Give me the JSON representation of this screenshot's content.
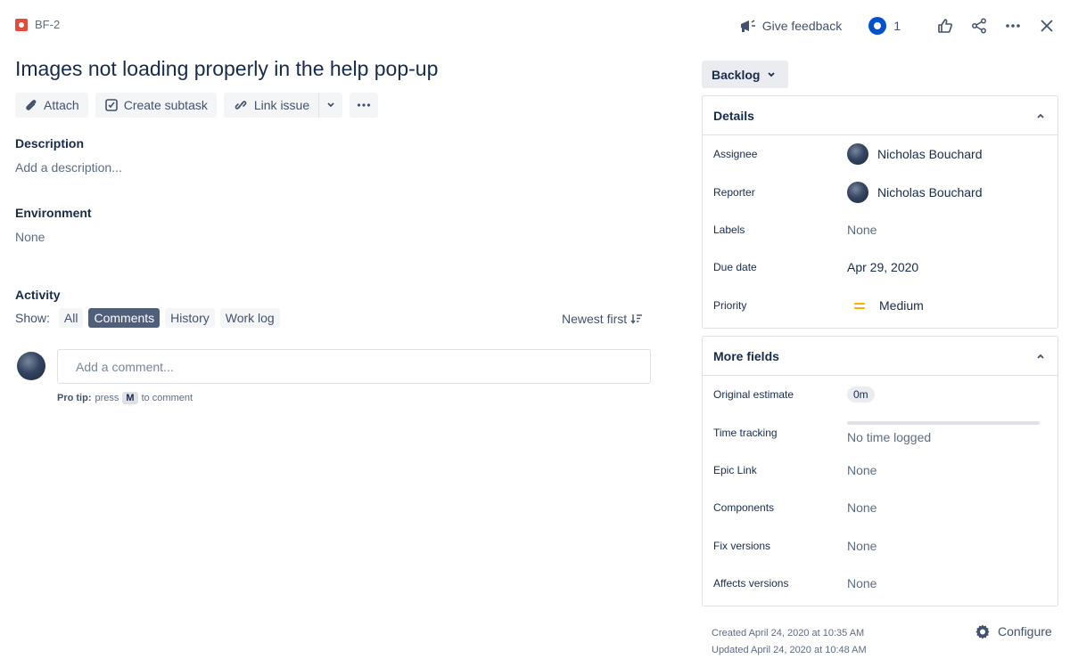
{
  "issue": {
    "key": "BF-2",
    "title": "Images not loading properly in the help pop-up"
  },
  "top_actions": {
    "feedback_label": "Give feedback",
    "watch_count": "1"
  },
  "actions": {
    "attach": "Attach",
    "create_subtask": "Create subtask",
    "link_issue": "Link issue"
  },
  "description": {
    "label": "Description",
    "placeholder": "Add a description..."
  },
  "environment": {
    "label": "Environment",
    "value": "None"
  },
  "activity": {
    "label": "Activity",
    "show_label": "Show:",
    "filters": [
      "All",
      "Comments",
      "History",
      "Work log"
    ],
    "active_filter": "Comments",
    "sort_label": "Newest first",
    "comment_placeholder": "Add a comment...",
    "protip_bold": "Pro tip:",
    "protip_press": "press",
    "protip_key": "M",
    "protip_rest": "to comment"
  },
  "status": {
    "label": "Backlog"
  },
  "details": {
    "header": "Details",
    "fields": {
      "assignee": {
        "label": "Assignee",
        "value": "Nicholas Bouchard"
      },
      "reporter": {
        "label": "Reporter",
        "value": "Nicholas Bouchard"
      },
      "labels": {
        "label": "Labels",
        "value": "None"
      },
      "due_date": {
        "label": "Due date",
        "value": "Apr 29, 2020"
      },
      "priority": {
        "label": "Priority",
        "value": "Medium"
      }
    }
  },
  "more_fields": {
    "header": "More fields",
    "fields": {
      "original_estimate": {
        "label": "Original estimate",
        "value": "0m"
      },
      "time_tracking": {
        "label": "Time tracking",
        "value": "No time logged",
        "progress": 0
      },
      "epic_link": {
        "label": "Epic Link",
        "value": "None"
      },
      "components": {
        "label": "Components",
        "value": "None"
      },
      "fix_versions": {
        "label": "Fix versions",
        "value": "None"
      },
      "affects_versions": {
        "label": "Affects versions",
        "value": "None"
      }
    }
  },
  "footer": {
    "created": "Created April 24, 2020 at 10:35 AM",
    "updated": "Updated April 24, 2020 at 10:48 AM",
    "configure_label": "Configure"
  },
  "icons": {
    "issue_type": "bug-icon",
    "feedback": "megaphone-icon",
    "watch": "eye-icon",
    "like": "thumbs-up-icon",
    "share": "share-icon",
    "more": "more-icon",
    "close": "close-icon",
    "attach": "paperclip-icon",
    "subtask": "subtask-icon",
    "link": "link-icon",
    "sort": "sort-icon",
    "configure": "gear-icon",
    "priority": "priority-medium-icon"
  },
  "colors": {
    "bug": "#e5493a",
    "watch": "#0052cc",
    "priority_medium": "#ffab00",
    "active_chip": "#505f79"
  }
}
